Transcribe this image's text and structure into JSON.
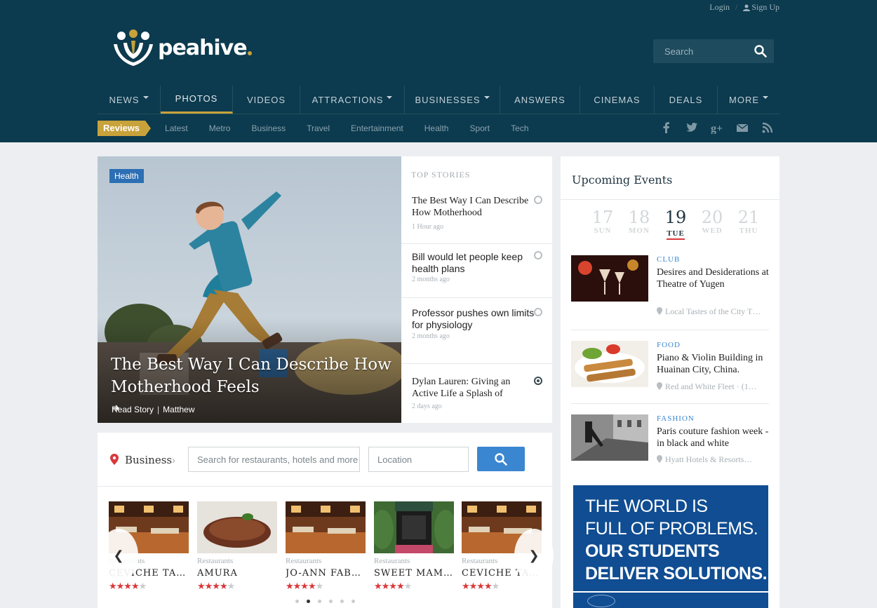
{
  "header": {
    "login": "Login",
    "separator": "/",
    "signup": "Sign Up",
    "logo_text": "peahive",
    "search_placeholder": "Search"
  },
  "nav": [
    {
      "label": "NEWS",
      "dropdown": true
    },
    {
      "label": "PHOTOS",
      "dropdown": false,
      "active": true
    },
    {
      "label": "VIDEOS",
      "dropdown": false
    },
    {
      "label": "ATTRACTIONS",
      "dropdown": true
    },
    {
      "label": "BUSINESSES",
      "dropdown": true
    },
    {
      "label": "ANSWERS",
      "dropdown": false
    },
    {
      "label": "CINEMAS",
      "dropdown": false
    },
    {
      "label": "DEALS",
      "dropdown": false
    },
    {
      "label": "MORE",
      "dropdown": true
    }
  ],
  "subnav": {
    "tag": "Reviews",
    "links": [
      "Latest",
      "Metro",
      "Business",
      "Travel",
      "Entertainment",
      "Health",
      "Sport",
      "Tech"
    ],
    "social": [
      "facebook-icon",
      "twitter-icon",
      "google-plus-icon",
      "mail-icon",
      "rss-icon"
    ]
  },
  "hero": {
    "tag": "Health",
    "title": "The Best Way I Can Describe How Motherhood Feels",
    "read_story": "Read Story",
    "author": "Matthew"
  },
  "top_stories": {
    "heading": "TOP STORIES",
    "items": [
      {
        "title": "The Best Way I Can Describe How Motherhood",
        "date": "1 Hour ago"
      },
      {
        "title": "Bill would let people keep health plans",
        "date": "2 months ago"
      },
      {
        "title": "Professor pushes own limits for physiology",
        "date": "2 months ago"
      },
      {
        "title": "Dylan Lauren: Giving an Active Life a Splash of",
        "date": "2 days ago"
      }
    ]
  },
  "business": {
    "label": "Business",
    "search_placeholder": "Search for restaurants, hotels and more",
    "location_placeholder": "Location",
    "items": [
      {
        "category": "Restaurants",
        "name": "CEVICHE TA…",
        "rating": 3.5
      },
      {
        "category": "Restaurants",
        "name": "AMURA",
        "rating": 3.5
      },
      {
        "category": "Restaurants",
        "name": "JO-ANN FAB…",
        "rating": 3.5
      },
      {
        "category": "Restaurants",
        "name": "SWEET MAM…",
        "rating": 3.5
      },
      {
        "category": "Restaurants",
        "name": "CEVICHE TA…",
        "rating": 3.5
      }
    ],
    "page_count": 6,
    "current_page": 2
  },
  "events": {
    "title": "Upcoming Events",
    "days": [
      {
        "num": "17",
        "day": "SUN"
      },
      {
        "num": "18",
        "day": "MON"
      },
      {
        "num": "19",
        "day": "TUE",
        "active": true
      },
      {
        "num": "20",
        "day": "WED"
      },
      {
        "num": "21",
        "day": "THU"
      }
    ],
    "items": [
      {
        "category": "CLUB",
        "name": "Desires and Desiderations at Theatre of Yugen",
        "location": "Local Tastes of the City T…"
      },
      {
        "category": "FOOD",
        "name": "Piano & Violin Building in Huainan City, China.",
        "location": "Red and White Fleet  ·  (1…"
      },
      {
        "category": "FASHION",
        "name": "Paris couture fashion week - in black and white",
        "location": "Hyatt Hotels & Resorts…"
      }
    ]
  },
  "ad": {
    "line1": "THE WORLD IS",
    "line2": "FULL OF PROBLEMS.",
    "line3": "OUR STUDENTS",
    "line4": "DELIVER SOLUTIONS."
  },
  "colors": {
    "header_bg": "#0c3a4e",
    "accent_gold": "#c8a23a",
    "link_blue": "#3b86d0",
    "star_red": "#d9383a",
    "ad_blue": "#104d92"
  }
}
